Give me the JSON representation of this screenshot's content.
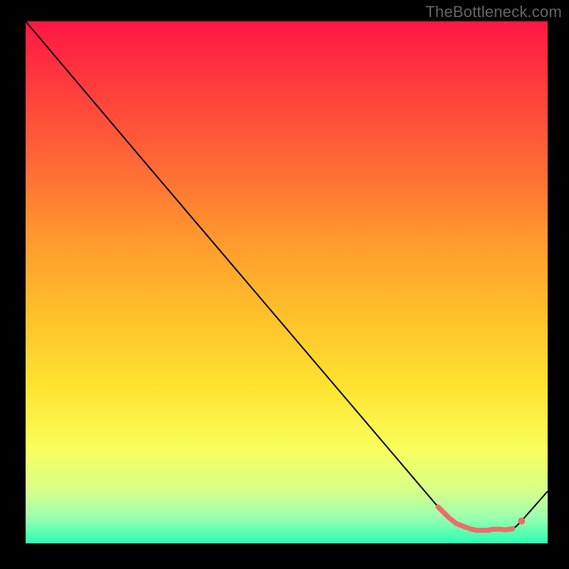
{
  "attribution": "TheBottleneck.com",
  "chart_data": {
    "type": "line",
    "title": "",
    "xlabel": "",
    "ylabel": "",
    "xlim": [
      0,
      100
    ],
    "ylim": [
      0,
      100
    ],
    "grid": false,
    "legend": "none",
    "background_gradient": {
      "stops": [
        {
          "offset": 0.0,
          "color": "#ff1744"
        },
        {
          "offset": 0.12,
          "color": "#ff3a3d"
        },
        {
          "offset": 0.28,
          "color": "#ff6b35"
        },
        {
          "offset": 0.42,
          "color": "#ff9a2e"
        },
        {
          "offset": 0.56,
          "color": "#ffc02a"
        },
        {
          "offset": 0.7,
          "color": "#ffe330"
        },
        {
          "offset": 0.82,
          "color": "#f9ff5c"
        },
        {
          "offset": 0.9,
          "color": "#d6ff8a"
        },
        {
          "offset": 0.95,
          "color": "#9cffb0"
        },
        {
          "offset": 1.0,
          "color": "#2affb0"
        }
      ]
    },
    "series": [
      {
        "name": "curve",
        "color": "#000000",
        "width": 2,
        "x": [
          0,
          22,
          79,
          81,
          82.5,
          84,
          85.5,
          86.5,
          87.5,
          88.5,
          89,
          89.5,
          91,
          92,
          93.3,
          94,
          95,
          100
        ],
        "y": [
          100,
          74,
          7,
          5,
          3.8,
          3.2,
          2.7,
          2.5,
          2.5,
          2.5,
          2.6,
          2.7,
          2.7,
          2.6,
          2.8,
          3.3,
          4.3,
          10
        ]
      },
      {
        "name": "highlight-segment",
        "color": "#ef6b6b",
        "width": 7,
        "cap": "round",
        "x": [
          79,
          81,
          82.5,
          84,
          85.5,
          86.5,
          87.5,
          88.5,
          89,
          89.5,
          91,
          92,
          93.3
        ],
        "y": [
          7,
          5,
          3.8,
          3.2,
          2.7,
          2.5,
          2.5,
          2.5,
          2.6,
          2.7,
          2.7,
          2.6,
          2.8
        ]
      },
      {
        "name": "highlight-dot",
        "type": "scatter",
        "color": "#ef6b6b",
        "radius": 5,
        "x": [
          95.0
        ],
        "y": [
          4.3
        ]
      }
    ]
  }
}
